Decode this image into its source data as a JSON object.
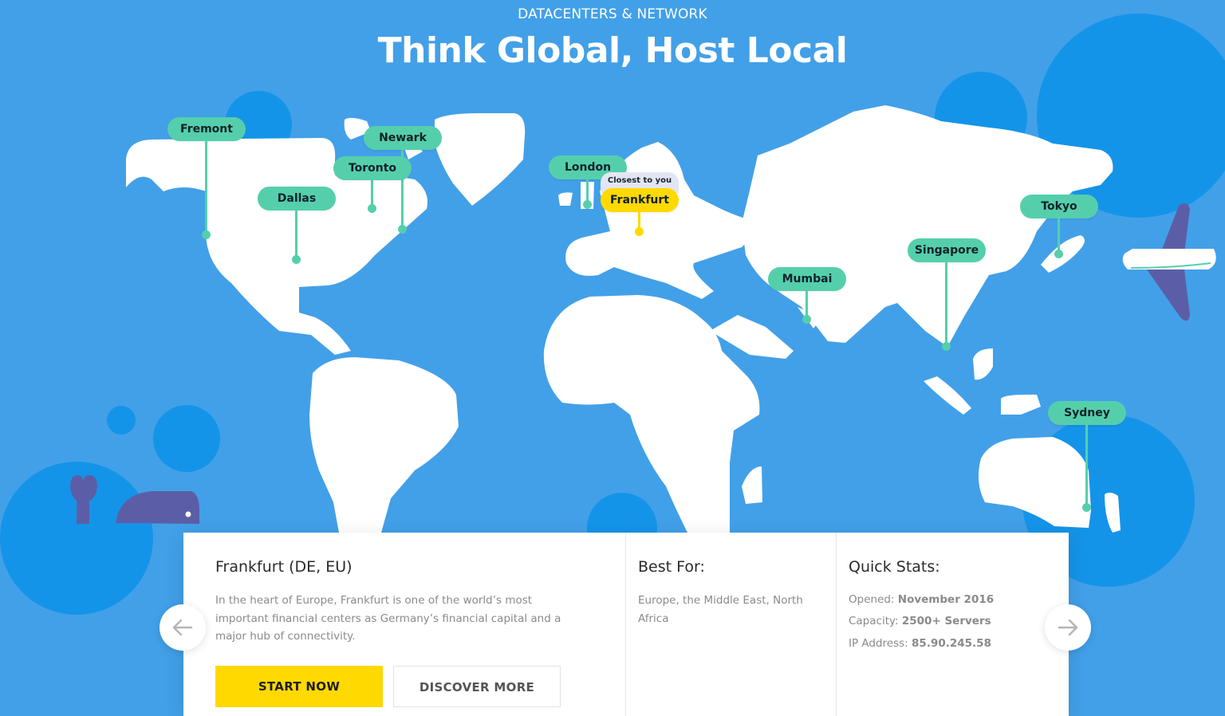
{
  "header": {
    "eyebrow": "DATACENTERS & NETWORK",
    "title": "Think Global, Host Local"
  },
  "pins": {
    "fremont": "Fremont",
    "newark": "Newark",
    "toronto": "Toronto",
    "dallas": "Dallas",
    "london": "London",
    "frankfurt": "Frankfurt",
    "mumbai": "Mumbai",
    "singapore": "Singapore",
    "tokyo": "Tokyo",
    "sydney": "Sydney",
    "closest_badge": "Closest to you"
  },
  "card": {
    "location_title": "Frankfurt (DE, EU)",
    "description": "In the heart of Europe, Frankfurt is one of the world’s most important financial centers as Germany’s financial capital and a major hub of connectivity.",
    "best_for_title": "Best For:",
    "best_for_text": "Europe, the Middle East, North Africa",
    "stats_title": "Quick Stats:",
    "opened_label": "Opened:",
    "opened_value": "November 2016",
    "capacity_label": "Capacity:",
    "capacity_value": "2500+ Servers",
    "ip_label": "IP Address:",
    "ip_value": "85.90.245.58",
    "start_label": "START NOW",
    "discover_label": "DISCOVER MORE"
  },
  "nav": {
    "prev_icon": "arrow-left-icon",
    "next_icon": "arrow-right-icon"
  },
  "colors": {
    "background": "#42a0e8",
    "pin": "#55cfab",
    "active_pin": "#ffd900",
    "land": "#ffffff",
    "circle": "#1494e8",
    "plane": "#5b5ea6"
  }
}
